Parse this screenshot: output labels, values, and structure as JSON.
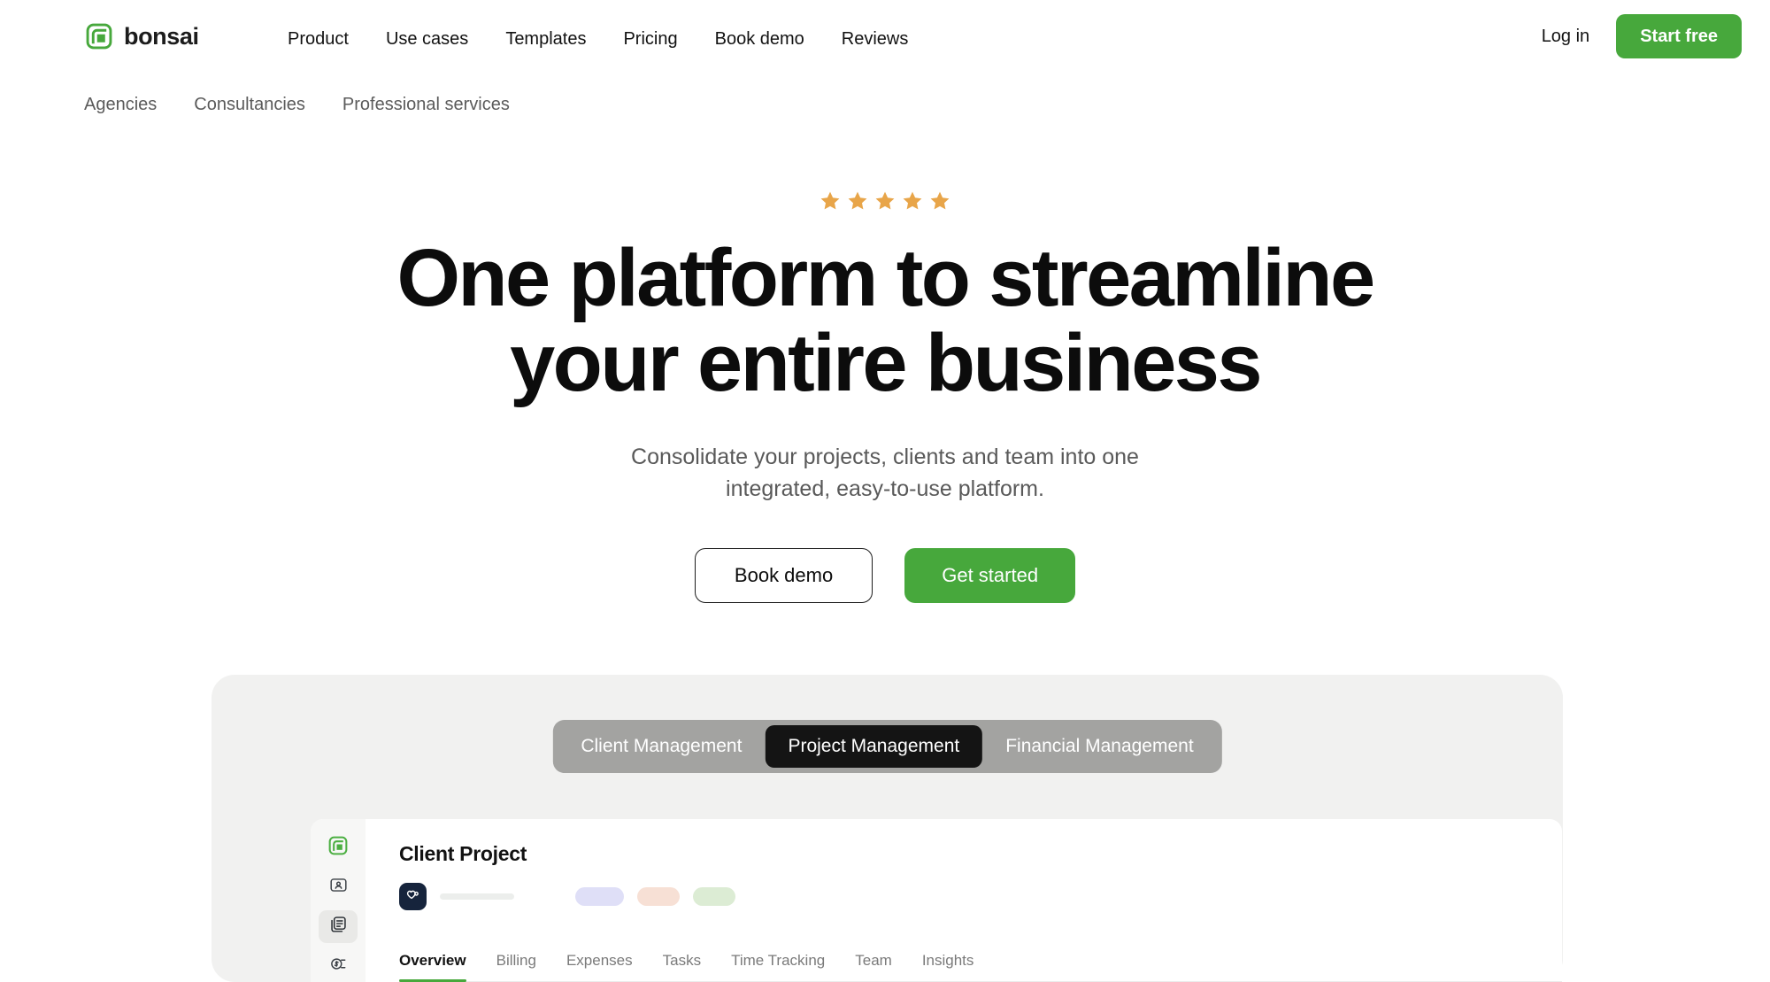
{
  "brand": {
    "name": "bonsai",
    "logo_icon": "bonsai-spiral-logo",
    "color": "#47a83c"
  },
  "topnav": {
    "links": [
      {
        "label": "Product"
      },
      {
        "label": "Use cases"
      },
      {
        "label": "Templates"
      },
      {
        "label": "Pricing"
      },
      {
        "label": "Book demo"
      },
      {
        "label": "Reviews"
      }
    ],
    "login_label": "Log in",
    "cta_label": "Start free",
    "cta_color": "#47a83c"
  },
  "subnav": {
    "links": [
      {
        "label": "Agencies"
      },
      {
        "label": "Consultancies"
      },
      {
        "label": "Professional services"
      }
    ]
  },
  "hero": {
    "rating": {
      "stars": 5,
      "icon": "star-icon",
      "color": "#e8a549"
    },
    "headline_line1": "One platform to streamline",
    "headline_line2": "your entire business",
    "subhead_line1": "Consolidate your projects, clients and team into one",
    "subhead_line2": "integrated, easy-to-use platform.",
    "secondary_cta": "Book demo",
    "primary_cta": "Get started",
    "primary_cta_color": "#47a83c"
  },
  "showcase": {
    "background": "#f1f1f0",
    "segments": [
      {
        "label": "Client Management",
        "active": false
      },
      {
        "label": "Project Management",
        "active": true
      },
      {
        "label": "Financial Management",
        "active": false
      }
    ],
    "segment_track_color": "#a3a3a1",
    "segment_active_color": "#141414"
  },
  "app": {
    "sidebar": [
      {
        "icon": "bonsai-logo-icon",
        "active": false
      },
      {
        "icon": "contact-card-icon",
        "active": false
      },
      {
        "icon": "documents-icon",
        "active": true
      },
      {
        "icon": "money-tag-icon",
        "active": false
      }
    ],
    "project_title": "Client Project",
    "avatar_icon": "heart-avatar-icon",
    "status_pills": [
      {
        "name": "pill-lavender",
        "color": "#dfdff7"
      },
      {
        "name": "pill-peach",
        "color": "#f7e0d5"
      },
      {
        "name": "pill-green",
        "color": "#dcecd4"
      }
    ],
    "tabs": [
      {
        "label": "Overview",
        "active": true
      },
      {
        "label": "Billing",
        "active": false
      },
      {
        "label": "Expenses",
        "active": false
      },
      {
        "label": "Tasks",
        "active": false
      },
      {
        "label": "Time Tracking",
        "active": false
      },
      {
        "label": "Team",
        "active": false
      },
      {
        "label": "Insights",
        "active": false
      }
    ],
    "active_tab_color": "#47a83c"
  }
}
